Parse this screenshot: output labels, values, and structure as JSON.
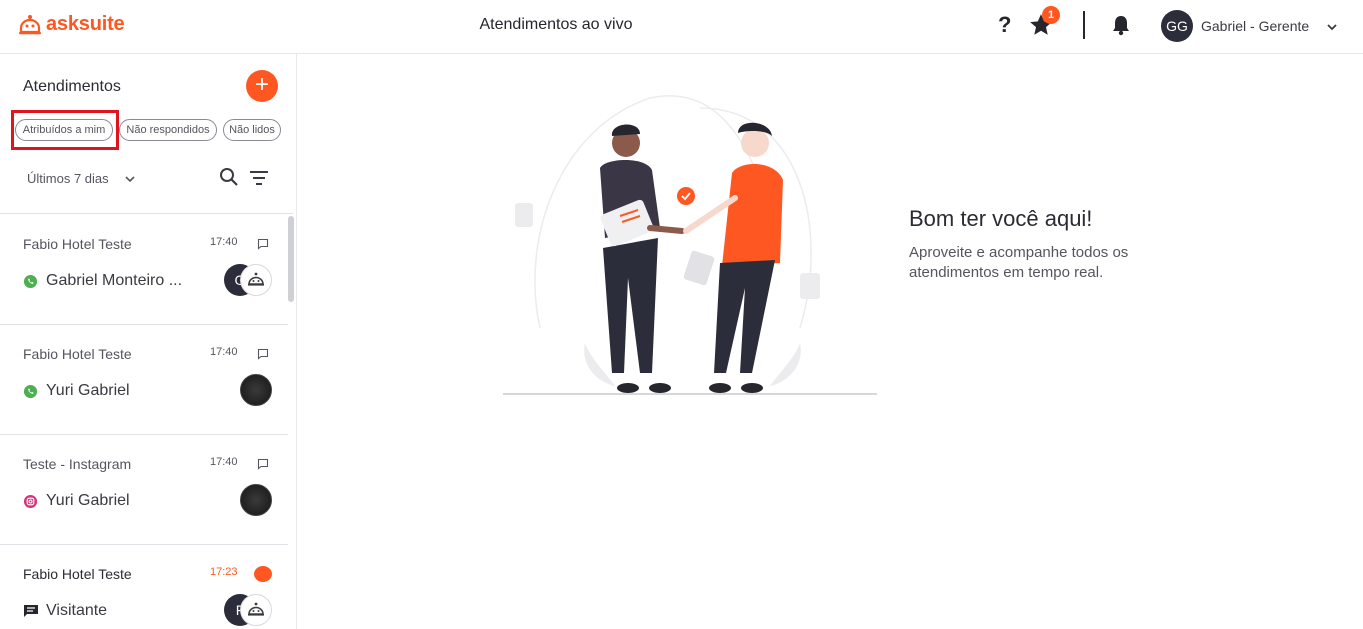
{
  "brand": {
    "name": "asksuite",
    "color": "#ff5722"
  },
  "header": {
    "title": "Atendimentos ao vivo",
    "help_icon": "question-icon",
    "favorites_badge": "1",
    "user_initials": "GG",
    "user_name": "Gabriel - Gerente"
  },
  "sidebar": {
    "title": "Atendimentos",
    "add_label": "+",
    "filters": [
      "Atribuídos a mim",
      "Não respondidos",
      "Não lidos"
    ],
    "period": "Últimos 7 dias",
    "conversations": [
      {
        "hotel": "Fabio Hotel Teste",
        "time": "17:40",
        "channel": "whatsapp",
        "name": "Gabriel Monteiro ...",
        "agent_initial": "G",
        "unread": false
      },
      {
        "hotel": "Fabio Hotel Teste",
        "time": "17:40",
        "channel": "whatsapp",
        "name": "Yuri Gabriel",
        "unread": false
      },
      {
        "hotel": "Teste - Instagram",
        "time": "17:40",
        "channel": "instagram",
        "name": "Yuri Gabriel",
        "unread": false
      },
      {
        "hotel": "Fabio Hotel Teste",
        "time": "17:23",
        "channel": "chat",
        "name": "Visitante",
        "agent_initial": "F",
        "unread": true
      }
    ]
  },
  "main": {
    "welcome_title": "Bom ter você aqui!",
    "welcome_text": "Aproveite e acompanhe todos os atendimentos em tempo real."
  },
  "colors": {
    "accent": "#ff5722",
    "dark": "#2b2d3b",
    "highlight": "#e0141e"
  }
}
